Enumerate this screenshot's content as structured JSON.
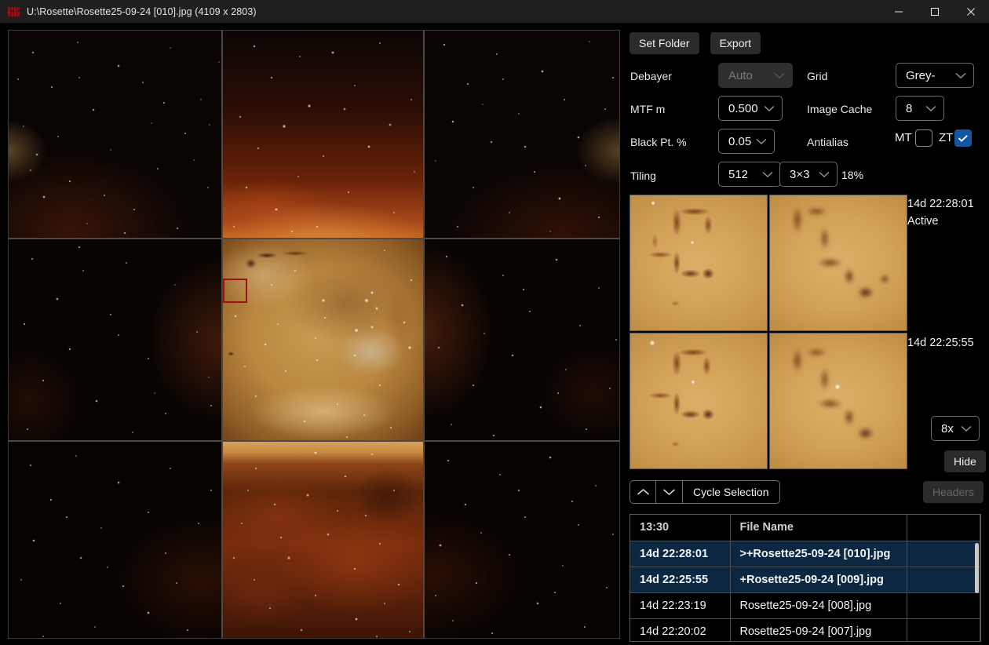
{
  "titlebar": {
    "logo_icon": "app-logo-icon",
    "title": "U:\\Rosette\\Rosette25-09-24 [010].jpg (4109 x 2803)",
    "minimize_icon": "minimize-icon",
    "maximize_icon": "maximize-icon",
    "close_icon": "close-icon"
  },
  "toolbar": {
    "set_folder": "Set Folder",
    "export": "Export"
  },
  "controls": {
    "debayer_label": "Debayer",
    "debayer_value": "Auto",
    "debayer_disabled": true,
    "grid_label": "Grid",
    "grid_value": "Grey-",
    "mtf_label": "MTF m",
    "mtf_value": "0.500",
    "image_cache_label": "Image Cache",
    "image_cache_value": "8",
    "black_pt_label": "Black Pt. %",
    "black_pt_value": "0.05",
    "antialias_label": "Antialias",
    "mt_label": "MT",
    "mt_checked": false,
    "zt_label": "ZT",
    "zt_checked": true,
    "tiling_label": "Tiling",
    "tiling_size": "512",
    "tiling_grid": "3×3",
    "tiling_pct": "18%",
    "accent_blue": "#14579e"
  },
  "previews": {
    "top_timestamp": "14d 22:28:01",
    "top_status": "Active",
    "bottom_timestamp": "14d 22:25:55",
    "zoom_value": "8x",
    "hide_label": "Hide"
  },
  "cycle": {
    "up_icon": "chevron-up-icon",
    "down_icon": "chevron-down-icon",
    "label": "Cycle Selection",
    "headers_label": "Headers",
    "headers_disabled": true
  },
  "file_table": {
    "columns": [
      "13:30",
      "File Name",
      ""
    ],
    "rows": [
      {
        "time": "14d 22:28:01",
        "name": ">+Rosette25-09-24 [010].jpg",
        "extra": "",
        "selected": true
      },
      {
        "time": "14d 22:25:55",
        "name": "+Rosette25-09-24 [009].jpg",
        "extra": "",
        "selected": true
      },
      {
        "time": "14d 22:23:19",
        "name": "Rosette25-09-24 [008].jpg",
        "extra": "",
        "selected": false
      },
      {
        "time": "14d 22:20:02",
        "name": "Rosette25-09-24 [007].jpg",
        "extra": "",
        "selected": false
      }
    ]
  },
  "image_view": {
    "tiling": "3x3",
    "selection_box_color": "#9c1118"
  }
}
